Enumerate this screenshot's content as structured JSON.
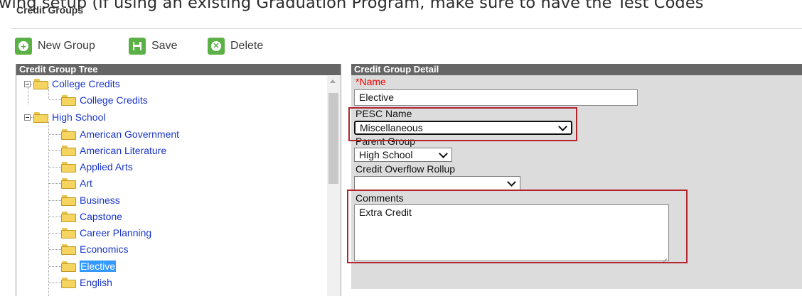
{
  "overlay_text": "wing setup (if using an existing Graduation Program, make sure to have the Test Codes",
  "window_title": "Credit Groups",
  "toolbar": {
    "new_group_label": "New Group",
    "save_label": "Save",
    "delete_label": "Delete"
  },
  "tree": {
    "header": "Credit Group Tree",
    "groups": [
      {
        "label": "College Credits",
        "children": [
          "College Credits"
        ]
      },
      {
        "label": "High School",
        "children": [
          "American Government",
          "American Literature",
          "Applied Arts",
          "Art",
          "Business",
          "Capstone",
          "Career Planning",
          "Economics",
          "Elective",
          "English"
        ]
      }
    ],
    "selected": "Elective"
  },
  "detail": {
    "header": "Credit Group Detail",
    "name_required_mark": "*",
    "name_label": "Name",
    "name_value": "Elective",
    "pesc_label": "PESC Name",
    "pesc_value": "Miscellaneous",
    "parent_label": "Parent Group",
    "parent_value": "High School",
    "overflow_label": "Credit Overflow Rollup",
    "overflow_value": "",
    "comments_label": "Comments",
    "comments_value": "Extra Credit"
  },
  "colors": {
    "accent_green": "#5bb146",
    "link_blue": "#1a35c8",
    "selection_blue": "#3399ff",
    "highlight_red": "#b3262d",
    "panel_header": "#666666"
  }
}
